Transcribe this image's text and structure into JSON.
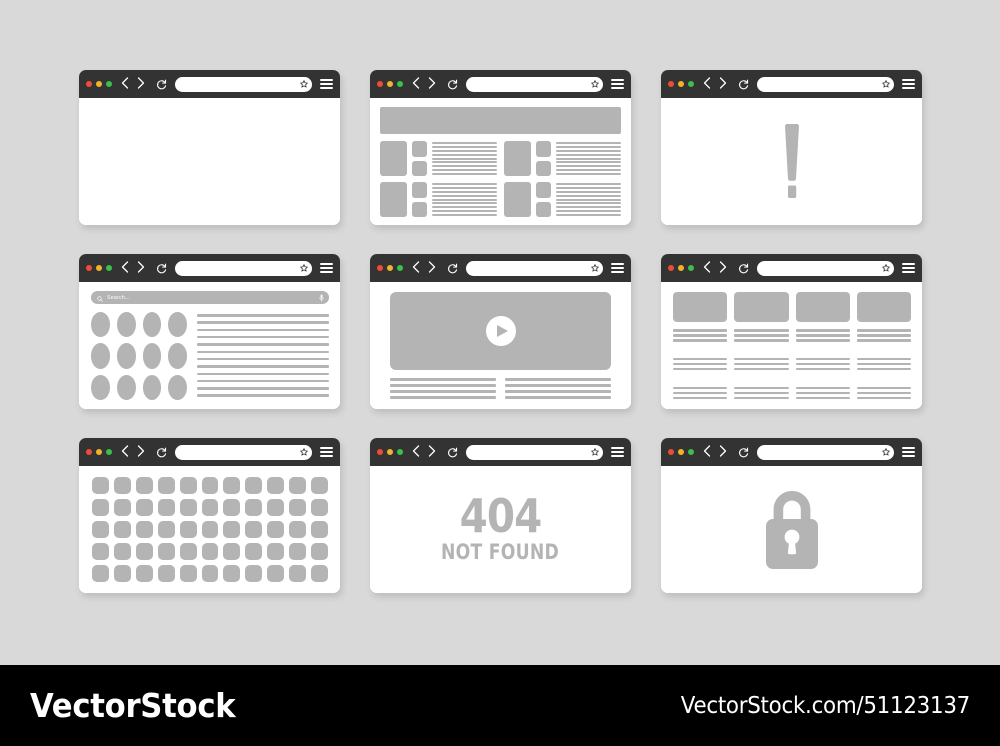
{
  "canvas": {
    "background_color": "#d9d9d9",
    "placeholder_gray": "#b4b4b4",
    "chrome_color": "#333333",
    "window_background": "#ffffff"
  },
  "browser_chrome": {
    "traffic_lights": [
      {
        "name": "close-dot",
        "color": "#ef4b3c"
      },
      {
        "name": "minimize-dot",
        "color": "#f2b32b"
      },
      {
        "name": "maximize-dot",
        "color": "#38c24b"
      }
    ],
    "back_icon": "chevron-left-icon",
    "forward_icon": "chevron-right-icon",
    "reload_icon": "reload-icon",
    "bookmark_icon": "star-icon",
    "menu_icon": "hamburger-menu-icon",
    "address_value": "",
    "address_placeholder": ""
  },
  "windows": [
    {
      "id": "blank-page",
      "name": "blank-browser-window",
      "content_type": "blank",
      "label": "Blank page"
    },
    {
      "id": "article-layout",
      "name": "article-layout-browser-window",
      "content_type": "article",
      "label": "Content page with hero banner, thumbnails and text blocks",
      "hero_blocks": 1,
      "rows": 2,
      "columns_per_row": 2,
      "text_lines_per_block": 9
    },
    {
      "id": "warning-page",
      "name": "warning-browser-window",
      "content_type": "exclamation",
      "label": "Warning / error exclamation mark page",
      "glyph": "exclamation-mark"
    },
    {
      "id": "search-page",
      "name": "search-browser-window",
      "content_type": "search",
      "label": "Search results page",
      "search": {
        "placeholder": "Search...",
        "value": "",
        "left_icon": "magnifier-icon",
        "right_icon": "microphone-icon"
      },
      "result_icons": 12,
      "result_lines": 12
    },
    {
      "id": "video-page",
      "name": "video-player-browser-window",
      "content_type": "video",
      "label": "Video player page",
      "play_icon": "play-button-icon",
      "caption_columns": 2,
      "caption_lines_per_column": 4
    },
    {
      "id": "multi-column",
      "name": "multi-column-browser-window",
      "content_type": "columns",
      "label": "Four column card layout",
      "columns": 4,
      "lines_per_column": 9
    },
    {
      "id": "gallery-grid",
      "name": "gallery-grid-browser-window",
      "content_type": "grid",
      "label": "Icon / thumbnail grid page",
      "grid_columns": 11,
      "grid_rows": 5
    },
    {
      "id": "not-found",
      "name": "not-found-browser-window",
      "content_type": "error-404",
      "label": "404 error page",
      "error_code": "404",
      "error_text": "NOT FOUND"
    },
    {
      "id": "secure-page",
      "name": "secure-lock-browser-window",
      "content_type": "lock",
      "label": "Secure / locked page",
      "glyph": "padlock-icon"
    }
  ],
  "watermark": {
    "brand": "VectorStock",
    "url": "VectorStock.com/51123137",
    "bar_color": "#000000",
    "text_color": "#ffffff"
  }
}
